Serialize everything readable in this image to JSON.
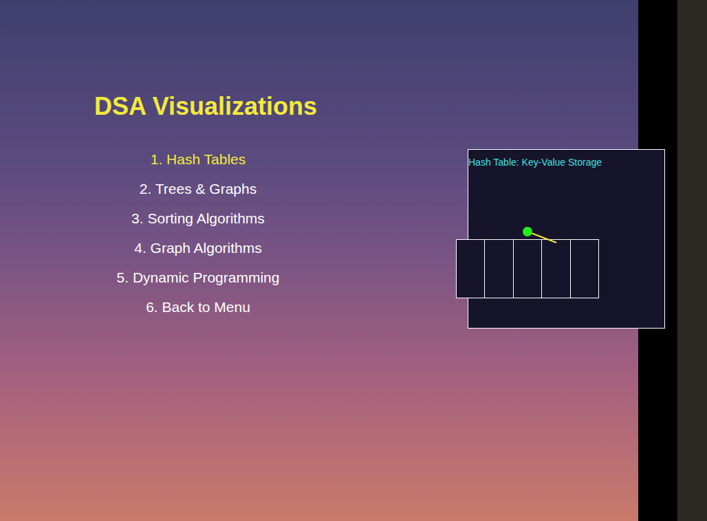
{
  "title": "DSA Visualizations",
  "menu": [
    {
      "label": "1. Hash Tables",
      "selected": true
    },
    {
      "label": "2. Trees & Graphs",
      "selected": false
    },
    {
      "label": "3. Sorting Algorithms",
      "selected": false
    },
    {
      "label": "4. Graph Algorithms",
      "selected": false
    },
    {
      "label": "5. Dynamic Programming",
      "selected": false
    },
    {
      "label": "6. Back to Menu",
      "selected": false
    }
  ],
  "preview": {
    "title": "Hash Table: Key-Value Storage",
    "buckets": [
      {
        "occupied": false
      },
      {
        "occupied": false
      },
      {
        "occupied": false
      },
      {
        "occupied": false
      },
      {
        "occupied": false
      }
    ]
  }
}
